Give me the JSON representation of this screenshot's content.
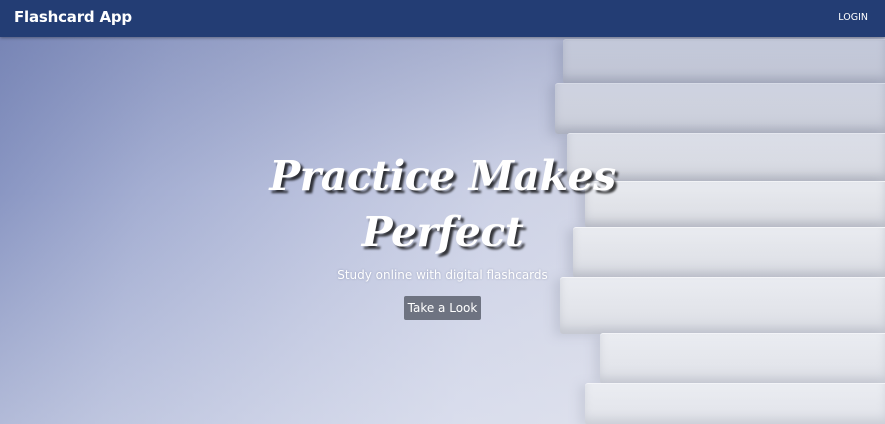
{
  "navbar": {
    "brand": "Flashcard App",
    "login_label": "LOGIN"
  },
  "hero": {
    "headline": "Practice Makes Perfect",
    "subheadline": "Study online with digital flashcards",
    "cta_label": "Take a Look",
    "background_image": "stack-of-books"
  },
  "colors": {
    "navbar": "#233d74",
    "button": "#6e7381",
    "text": "#ffffff"
  }
}
